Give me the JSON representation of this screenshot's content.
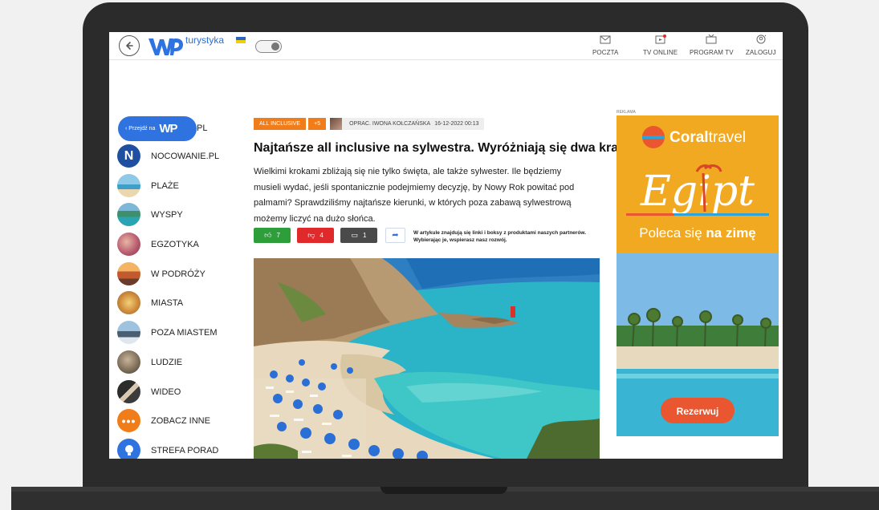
{
  "brand": {
    "name": "turystyka"
  },
  "topnav": [
    {
      "label": "POCZTA",
      "icon": "mail-icon"
    },
    {
      "label": "TV ONLINE",
      "icon": "tv-online-icon"
    },
    {
      "label": "PROGRAM TV",
      "icon": "tv-program-icon"
    },
    {
      "label": "ZALOGUJ",
      "icon": "user-icon"
    }
  ],
  "przejdz": {
    "label": "Przejdź na",
    "logo": "WP"
  },
  "sidebar": {
    "items": [
      {
        "label": "NOCOWANIE.PL",
        "icon": "nocowanie-icon"
      },
      {
        "label": "PLAŻE",
        "icon": "beach-thumb"
      },
      {
        "label": "WYSPY",
        "icon": "island-thumb"
      },
      {
        "label": "EGZOTYKA",
        "icon": "exotic-thumb"
      },
      {
        "label": "W PODRÓŻY",
        "icon": "travel-thumb"
      },
      {
        "label": "MIASTA",
        "icon": "city-thumb"
      },
      {
        "label": "POZA MIASTEM",
        "icon": "countryside-thumb"
      },
      {
        "label": "LUDZIE",
        "icon": "people-thumb"
      },
      {
        "label": "WIDEO",
        "icon": "video-thumb"
      },
      {
        "label": "ZOBACZ INNE",
        "icon": "more-icon"
      },
      {
        "label": "STREFA PORAD",
        "icon": "bulb-icon"
      }
    ],
    "partial_label": "PL"
  },
  "article": {
    "tags": [
      "ALL INCLUSIVE",
      "+5"
    ],
    "author": "OPRAC. IWONA KOŁCZAŃSKA",
    "date": "16-12-2022 00:13",
    "title": "Najtańsze all inclusive na sylwestra. Wyróżniają się dwa kraje",
    "lead": "Wielkimi krokami zbliżają się nie tylko święta, ale także sylwester. Ile będziemy musieli wydać, jeśli spontanicznie podejmiemy decyzję, by Nowy Rok powitać pod palmami? Sprawdziliśmy najtańsze kierunki, w których poza zabawą sylwestrową możemy liczyć na dużo słońca.",
    "likes": "7",
    "dislikes": "4",
    "comments": "1",
    "note": "W artykule znajdują się linki i boksy z produktami naszych partnerów. Wybierając je, wspierasz nasz rozwój."
  },
  "ad": {
    "label": "REKLAMA",
    "brand_a": "Coral",
    "brand_b": "travel",
    "headline": "Egipt",
    "tagline_a": "Poleca się ",
    "tagline_b": "na zimę",
    "cta": "Rezerwuj"
  },
  "colors": {
    "accent_blue": "#2f73e0",
    "orange": "#f07d1a",
    "like_green": "#2e9e3a",
    "dislike_red": "#e0292a",
    "comment_gray": "#4a4a4a",
    "ad_yellow": "#f2a922"
  }
}
